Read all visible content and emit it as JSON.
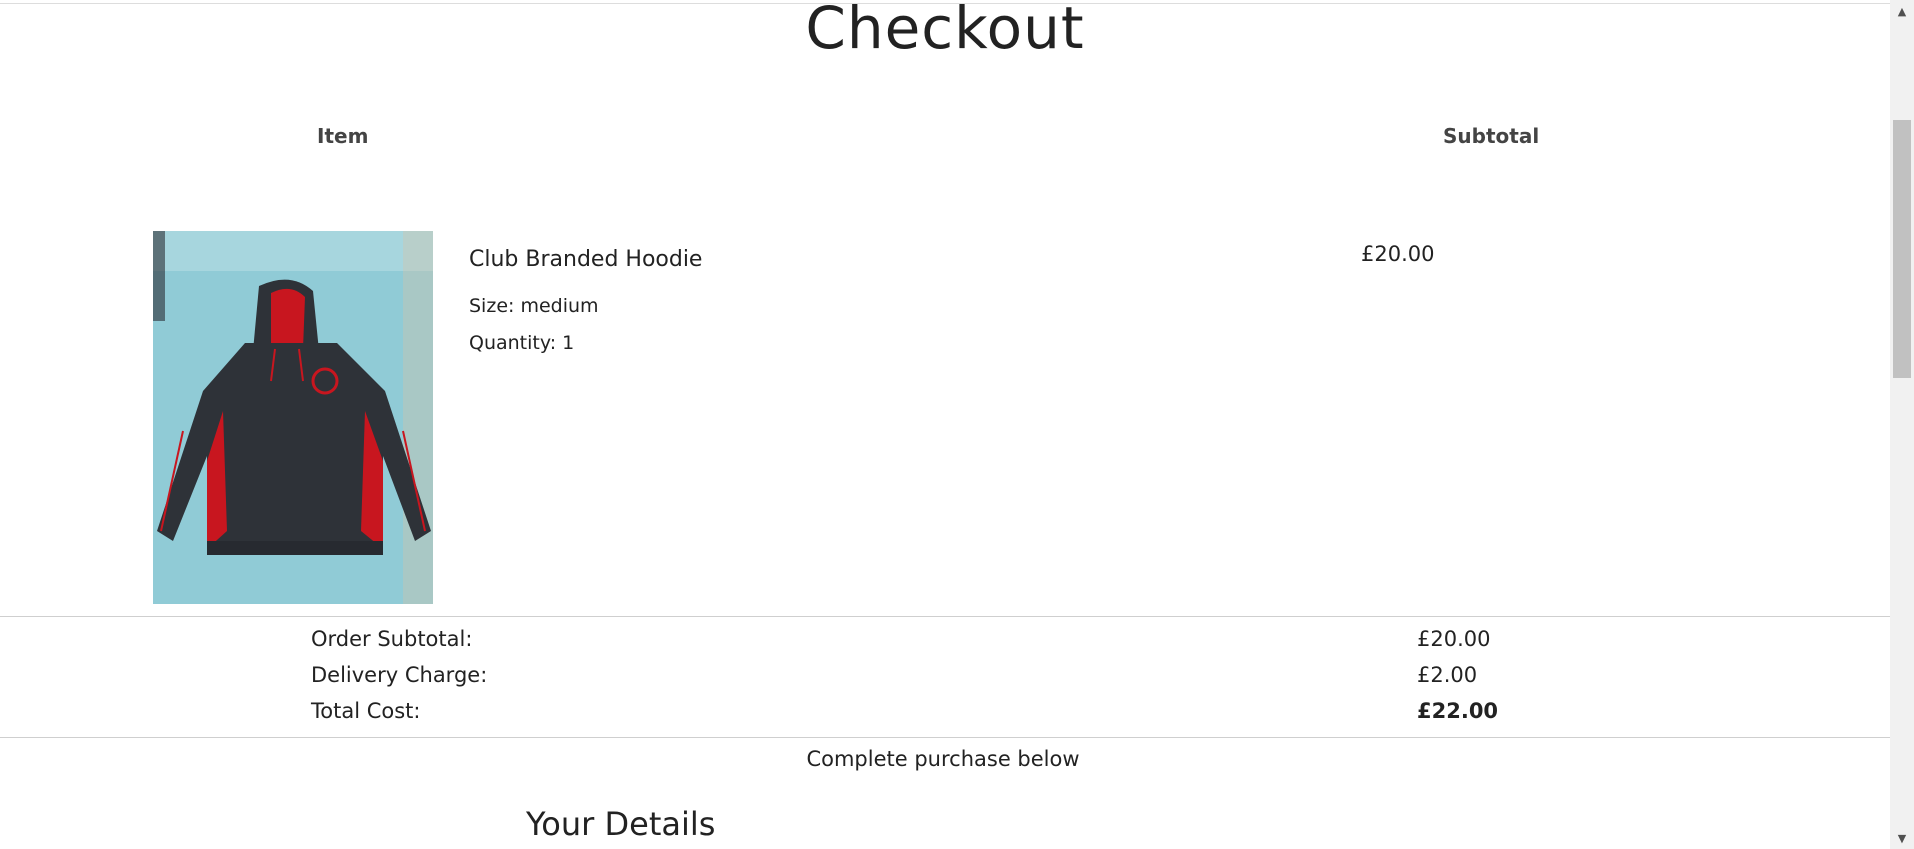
{
  "page": {
    "title": "Checkout"
  },
  "columns": {
    "item_label": "Item",
    "subtotal_label": "Subtotal"
  },
  "line_item": {
    "name": "Club Branded Hoodie",
    "size": "Size: medium",
    "quantity": "Quantity: 1",
    "subtotal": "£20.00",
    "image_alt_icon": "hoodie-image"
  },
  "summary": {
    "order_subtotal_label": "Order Subtotal:",
    "order_subtotal_value": "£20.00",
    "delivery_label": "Delivery Charge:",
    "delivery_value": "£2.00",
    "total_label": "Total Cost:",
    "total_value": "£22.00"
  },
  "complete_note": "Complete purchase below",
  "details_heading": "Your Details",
  "scrollbar": {
    "up_icon": "scroll-up-arrow-icon",
    "down_icon": "scroll-down-arrow-icon"
  },
  "colors": {
    "hoodie_body": "#2e3238",
    "hoodie_accent": "#c8161f",
    "background_sheet": "#8ec9d4"
  }
}
